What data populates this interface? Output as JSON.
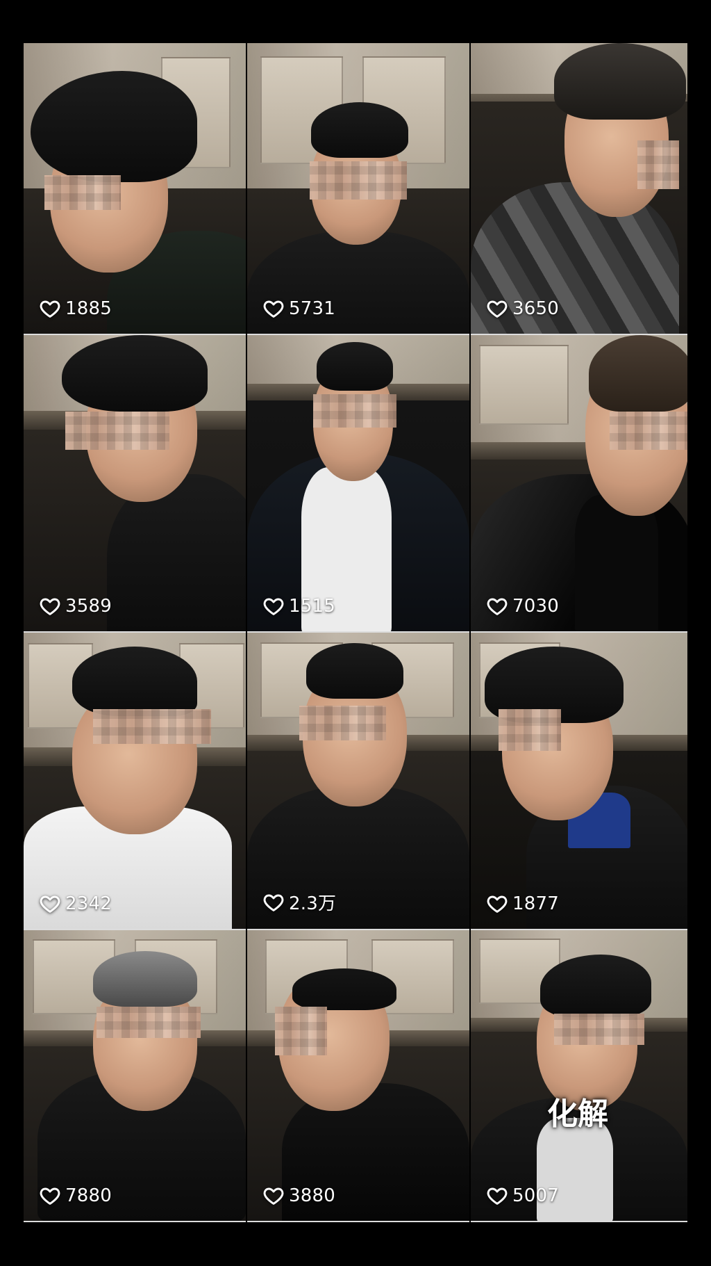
{
  "colors": {
    "background": "#000000",
    "like_text": "#ffffff",
    "tile_divider": "#dddddd"
  },
  "icons": {
    "like": "heart-outline-icon"
  },
  "videos": [
    {
      "likes": "1885",
      "shirt": "#1a1f1a"
    },
    {
      "likes": "5731",
      "shirt": "#1c1c1c"
    },
    {
      "likes": "3650",
      "shirt": "#3a3a3a"
    },
    {
      "likes": "3589",
      "shirt": "#151515"
    },
    {
      "likes": "1515",
      "shirt": "#e8e8e8"
    },
    {
      "likes": "7030",
      "shirt": "#0e0e0e"
    },
    {
      "likes": "2342",
      "shirt": "#f2f2f2"
    },
    {
      "likes": "2.3万",
      "shirt": "#1a1a1a"
    },
    {
      "likes": "1877",
      "shirt": "#1f3a8a"
    },
    {
      "likes": "7880",
      "shirt": "#161616"
    },
    {
      "likes": "3880",
      "shirt": "#0f0f0f"
    },
    {
      "likes": "5007",
      "shirt": "#d9d9d9",
      "caption": "化解"
    }
  ]
}
